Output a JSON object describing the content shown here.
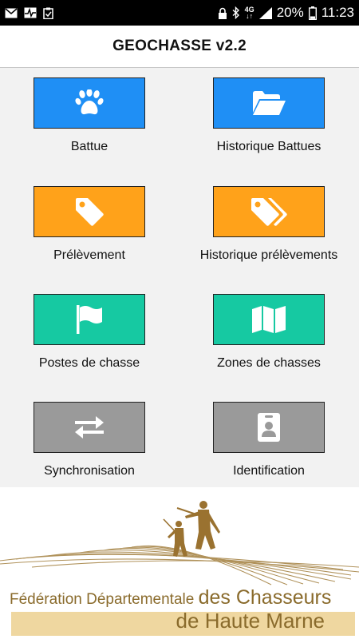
{
  "status_bar": {
    "network": "4G",
    "battery": "20%",
    "time": "11:23"
  },
  "app": {
    "title": "GEOCHASSE v2.2"
  },
  "menu": [
    {
      "label": "Battue",
      "icon": "paw-icon",
      "color": "#1f8ff5"
    },
    {
      "label": "Historique Battues",
      "icon": "folder-open-icon",
      "color": "#1f8ff5"
    },
    {
      "label": "Prélèvement",
      "icon": "tag-icon",
      "color": "#ffa21a"
    },
    {
      "label": "Historique prélèvements",
      "icon": "tags-icon",
      "color": "#ffa21a"
    },
    {
      "label": "Postes de chasse",
      "icon": "flag-icon",
      "color": "#16c9a2"
    },
    {
      "label": "Zones de chasses",
      "icon": "map-icon",
      "color": "#16c9a2"
    },
    {
      "label": "Synchronisation",
      "icon": "exchange-icon",
      "color": "#9a9a9a"
    },
    {
      "label": "Identification",
      "icon": "id-badge-icon",
      "color": "#9a9a9a"
    }
  ],
  "footer_logo": {
    "line1_prefix": "Fédération Départementale",
    "line1_suffix": "des Chasseurs",
    "line2": "de Haute Marne",
    "brand_color": "#8a6b2c"
  }
}
